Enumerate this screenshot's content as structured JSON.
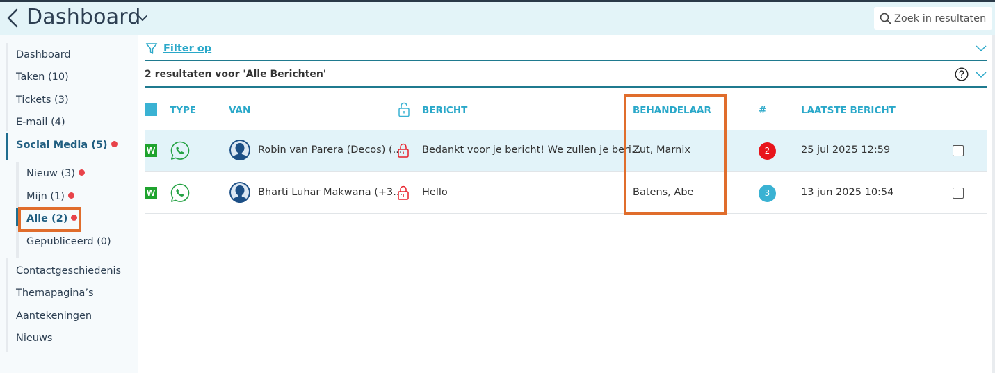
{
  "header": {
    "title": "Dashboard",
    "search_placeholder": "Zoek in resultaten"
  },
  "sidebar": {
    "items": [
      {
        "label": "Dashboard"
      },
      {
        "label": "Taken (10)"
      },
      {
        "label": "Tickets (3)"
      },
      {
        "label": "E-mail (4)"
      },
      {
        "label": "Social Media (5)"
      },
      {
        "label": "Contactgeschiedenis"
      },
      {
        "label": "Themapagina’s"
      },
      {
        "label": "Aantekeningen"
      },
      {
        "label": "Nieuws"
      }
    ],
    "sub_items": [
      {
        "label": "Nieuw (3)"
      },
      {
        "label": "Mijn (1)"
      },
      {
        "label": "Alle (2)"
      },
      {
        "label": "Gepubliceerd (0)"
      }
    ]
  },
  "filter": {
    "label": "Filter op"
  },
  "results": {
    "summary": "2 resultaten voor 'Alle Berichten'"
  },
  "table": {
    "headers": {
      "type": "TYPE",
      "van": "VAN",
      "bericht": "BERICHT",
      "behandelaar": "BEHANDELAAR",
      "count": "#",
      "laatste": "LAATSTE BERICHT"
    },
    "rows": [
      {
        "channel_badge": "W",
        "van": "Robin van Parera (Decos) (...",
        "bericht": "Bedankt voor je bericht! We zullen je beri...",
        "behandelaar": "Zut, Marnix",
        "count": "2",
        "count_color": "#e8141b",
        "laatste": "25 jul 2025 12:59",
        "selected": true
      },
      {
        "channel_badge": "W",
        "van": "Bharti Luhar Makwana (+3...",
        "bericht": "Hello",
        "behandelaar": "Batens, Abe",
        "count": "3",
        "count_color": "#3ab2d3",
        "laatste": "13 jun 2025 10:54",
        "selected": false
      }
    ]
  },
  "colors": {
    "accent": "#2aa8c9",
    "highlight": "#e06d2c",
    "alert_dot": "#e8434a",
    "whatsapp": "#25a244"
  }
}
